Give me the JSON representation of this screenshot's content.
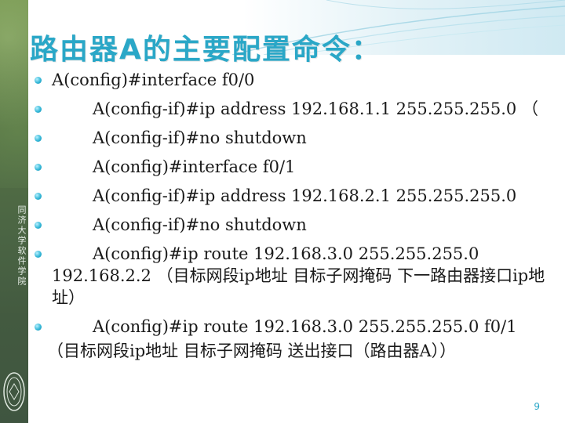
{
  "slide": {
    "title": "路由器A的主要配置命令：",
    "school_name": "同济大学软件学院",
    "page_number": "9"
  },
  "commands": [
    {
      "text": "A(config)#interface f0/0",
      "indent": false
    },
    {
      "text": "A(config-if)#ip address 192.168.1.1 255.255.255.0 （",
      "indent": true
    },
    {
      "text": "A(config-if)#no shutdown",
      "indent": true
    },
    {
      "text": "A(config)#interface f0/1",
      "indent": true
    },
    {
      "text": "A(config-if)#ip address 192.168.2.1 255.255.255.0",
      "indent": true
    },
    {
      "text": "A(config-if)#no shutdown",
      "indent": true
    },
    {
      "text": "A(config)#ip route 192.168.3.0 255.255.255.0 192.168.2.2 （目标网段ip地址 目标子网掩码 下一路由器接口ip地址）",
      "indent": true
    },
    {
      "text": "A(config)#ip route 192.168.3.0 255.255.255.0 f0/1",
      "indent": true
    }
  ],
  "continuation": "（目标网段ip地址 目标子网掩码 送出接口（路由器A））",
  "colors": {
    "title": "#2aa7c7",
    "bullet": "#33b7d7",
    "sidebar": "#4b6544"
  }
}
